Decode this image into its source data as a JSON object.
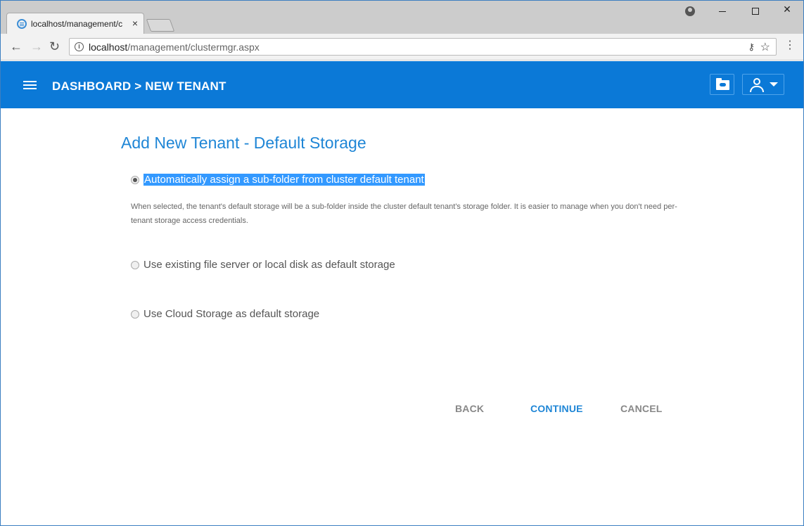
{
  "browser": {
    "tab_title": "localhost/management/c",
    "tab_close": "×",
    "url_host": "localhost",
    "url_path": "/management/clustermgr.aspx",
    "window_controls": {
      "minimize": "",
      "maximize": "",
      "close": "✕"
    }
  },
  "header": {
    "breadcrumb": "DASHBOARD > NEW TENANT",
    "accent_color": "#0b79d7"
  },
  "main": {
    "title": "Add New Tenant - Default Storage",
    "options": [
      {
        "label": "Automatically assign a sub-folder from cluster default tenant",
        "selected": true
      },
      {
        "label": "Use existing file server or local disk as default storage",
        "selected": false
      },
      {
        "label": "Use Cloud Storage as default storage",
        "selected": false
      }
    ],
    "description": "When selected, the tenant's default storage will be a sub-folder inside the cluster default tenant's storage folder. It is easier to manage when you don't need per-tenant storage access credentials."
  },
  "actions": {
    "back": "BACK",
    "continue": "CONTINUE",
    "cancel": "CANCEL"
  }
}
